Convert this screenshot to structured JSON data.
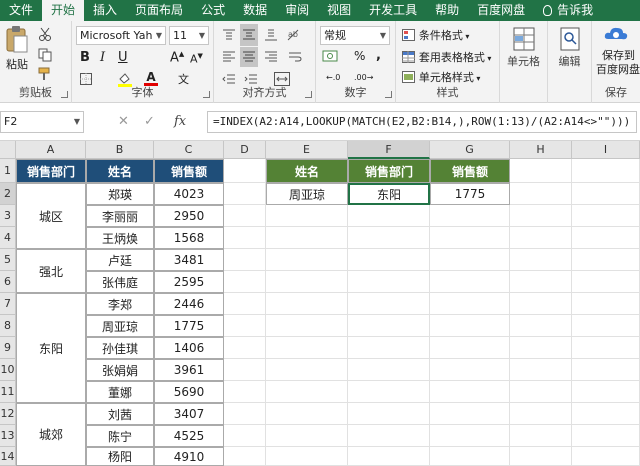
{
  "tabs": [
    "文件",
    "开始",
    "插入",
    "页面布局",
    "公式",
    "数据",
    "审阅",
    "视图",
    "开发工具",
    "帮助",
    "百度网盘",
    "告诉我"
  ],
  "ribbon": {
    "clipboard": {
      "paste": "粘贴",
      "label": "剪贴板"
    },
    "font": {
      "name": "Microsoft Yah",
      "size": "11",
      "label": "字体"
    },
    "alignment": {
      "label": "对齐方式"
    },
    "number": {
      "format": "常规",
      "label": "数字"
    },
    "styles": {
      "conditional": "条件格式",
      "table": "套用表格格式",
      "cell": "单元格样式",
      "label": "样式"
    },
    "cells": {
      "label": "单元格"
    },
    "editing": {
      "label": "编辑"
    },
    "save": {
      "line1": "保存到",
      "line2": "百度网盘",
      "label": "保存"
    }
  },
  "formula_bar": {
    "name_box": "F2",
    "fx": "fx",
    "formula": "=INDEX(A2:A14,LOOKUP(MATCH(E2,B2:B14,),ROW(1:13)/(A2:A14<>\"\")))"
  },
  "columns": [
    "A",
    "B",
    "C",
    "D",
    "E",
    "F",
    "G",
    "H",
    "I"
  ],
  "rows": [
    "1",
    "2",
    "3",
    "4",
    "5",
    "6",
    "7",
    "8",
    "9",
    "10",
    "11",
    "12",
    "13",
    "14"
  ],
  "table1": {
    "headers": [
      "销售部门",
      "姓名",
      "销售额"
    ],
    "groups": [
      {
        "dept": "城区",
        "rows": [
          [
            "郑瑛",
            "4023"
          ],
          [
            "李丽丽",
            "2950"
          ],
          [
            "王炳焕",
            "1568"
          ]
        ]
      },
      {
        "dept": "强北",
        "rows": [
          [
            "卢廷",
            "3481"
          ],
          [
            "张伟庭",
            "2595"
          ]
        ]
      },
      {
        "dept": "东阳",
        "rows": [
          [
            "李郑",
            "2446"
          ],
          [
            "周亚琼",
            "1775"
          ],
          [
            "孙佳琪",
            "1406"
          ],
          [
            "张娟娟",
            "3961"
          ],
          [
            "董娜",
            "5690"
          ]
        ]
      },
      {
        "dept": "城郊",
        "rows": [
          [
            "刘茜",
            "3407"
          ],
          [
            "陈宁",
            "4525"
          ],
          [
            "杨阳",
            "4910"
          ]
        ]
      }
    ]
  },
  "table2": {
    "headers": [
      "姓名",
      "销售部门",
      "销售额"
    ],
    "row": [
      "周亚琼",
      "东阳",
      "1775"
    ]
  },
  "colors": {
    "ribbon_green": "#217346",
    "header_blue": "#1f4e79",
    "header_green": "#548235"
  }
}
